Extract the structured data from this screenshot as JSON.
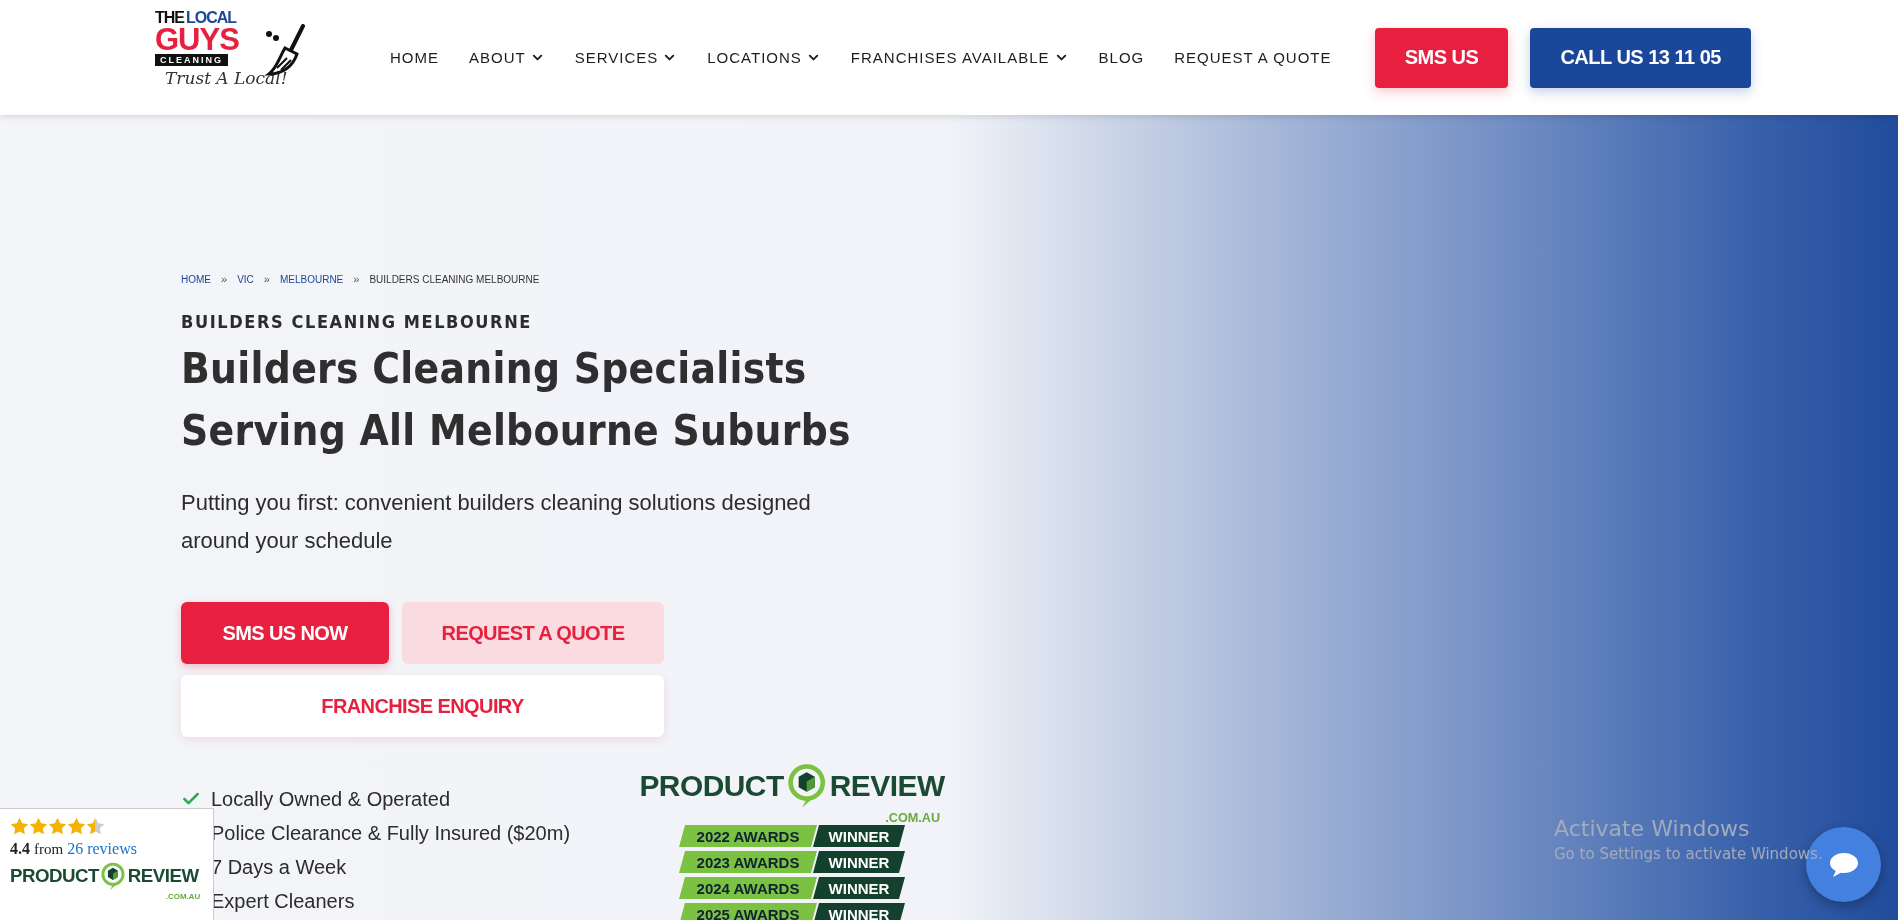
{
  "logo": {
    "the": "THE",
    "local": "LOCAL",
    "guys": "GUYS",
    "cleaning": "CLEANING",
    "tagline": "Trust A Local!"
  },
  "nav": [
    {
      "label": "HOME",
      "has_menu": false
    },
    {
      "label": "ABOUT",
      "has_menu": true
    },
    {
      "label": "SERVICES",
      "has_menu": true
    },
    {
      "label": "LOCATIONS",
      "has_menu": true
    },
    {
      "label": "FRANCHISES AVAILABLE",
      "has_menu": true
    },
    {
      "label": "BLOG",
      "has_menu": false
    },
    {
      "label": "REQUEST A QUOTE",
      "has_menu": false
    }
  ],
  "header_buttons": [
    {
      "label": "SMS US",
      "kind": "red"
    },
    {
      "label": "CALL US 13 11 05",
      "kind": "blue"
    }
  ],
  "breadcrumb": [
    {
      "label": "HOME",
      "link": true
    },
    {
      "label": "VIC",
      "link": true
    },
    {
      "label": "MELBOURNE",
      "link": true
    },
    {
      "label": "BUILDERS CLEANING MELBOURNE",
      "link": false
    }
  ],
  "breadcrumb_separator": "»",
  "eyebrow": "BUILDERS CLEANING MELBOURNE",
  "heading": [
    "Builders Cleaning Specialists",
    "Serving All Melbourne Suburbs"
  ],
  "lead": "Putting you first: convenient builders cleaning solutions designed around your schedule",
  "hero_buttons": [
    {
      "label": "SMS US NOW",
      "kind": "primary"
    },
    {
      "label": "REQUEST A QUOTE",
      "kind": "soft"
    },
    {
      "label": "FRANCHISE ENQUIRY",
      "kind": "white"
    }
  ],
  "features": [
    "Locally Owned & Operated",
    "Police Clearance & Fully Insured ($20m)",
    "7 Days a Week",
    "Expert Cleaners"
  ],
  "product_review": {
    "product": "PRODUCT",
    "review": "REVIEW",
    "domain": ".COM.AU"
  },
  "awards": [
    {
      "year": "2022 AWARDS",
      "result": "WINNER"
    },
    {
      "year": "2023 AWARDS",
      "result": "WINNER"
    },
    {
      "year": "2024 AWARDS",
      "result": "WINNER"
    },
    {
      "year": "2025 AWARDS",
      "result": "WINNER"
    }
  ],
  "rating_widget": {
    "stars": 4.5,
    "score": "4.4",
    "from": "from",
    "reviews": "26 reviews",
    "product": "PRODUCT",
    "review": "REVIEW",
    "domain": ".COM.AU"
  },
  "os_notice": {
    "title": "Activate Windows",
    "text": "Go to Settings to activate Windows."
  }
}
